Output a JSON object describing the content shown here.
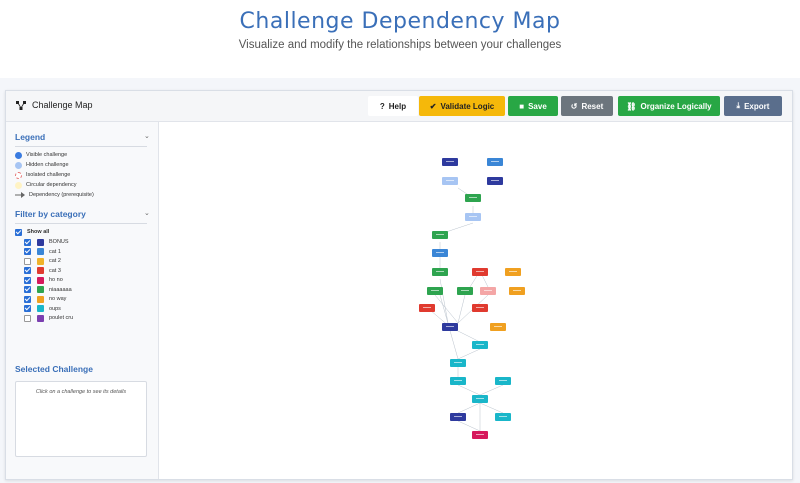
{
  "header": {
    "title": "Challenge Dependency Map",
    "subtitle": "Visualize and modify the relationships between your challenges"
  },
  "toolbar": {
    "title": "Challenge Map",
    "title_icon": "graph-icon",
    "buttons": [
      {
        "label": "Help",
        "icon": "question-circle-icon",
        "color": "#ffffff",
        "text": "#222222"
      },
      {
        "label": "Validate Logic",
        "icon": "check-circle-icon",
        "color": "#f5b80a",
        "text": "#222222"
      },
      {
        "label": "Save",
        "icon": "floppy-icon",
        "color": "#28a745",
        "text": "#ffffff"
      },
      {
        "label": "Reset",
        "icon": "undo-icon",
        "color": "#6c757d",
        "text": "#ffffff"
      },
      {
        "label": "Organize Logically",
        "icon": "graph-icon",
        "color": "#28a745",
        "text": "#ffffff"
      },
      {
        "label": "Export",
        "icon": "download-icon",
        "color": "#5a6e8c",
        "text": "#ffffff"
      }
    ]
  },
  "legend": {
    "title": "Legend",
    "items": [
      {
        "label": "Visible challenge",
        "type": "visible",
        "color": "#3a7be0"
      },
      {
        "label": "Hidden challenge",
        "type": "hidden",
        "color": "#a7c5f3"
      },
      {
        "label": "Isolated challenge",
        "type": "isolated",
        "color": "#e57373"
      },
      {
        "label": "Circular dependency",
        "type": "circular",
        "color": "#fff3c4"
      },
      {
        "label": "Dependency (prerequisite)",
        "type": "arrow",
        "color": "#666666"
      }
    ]
  },
  "filter": {
    "title": "Filter by category",
    "show_all_label": "Show all",
    "show_all_checked": true,
    "categories": [
      {
        "label": "BONUS",
        "color": "#2e3a9e",
        "checked": true
      },
      {
        "label": "cat 1",
        "color": "#3a86d6",
        "checked": true
      },
      {
        "label": "cat 2",
        "color": "#f0b32a",
        "checked": false
      },
      {
        "label": "cat 3",
        "color": "#e03a2f",
        "checked": true
      },
      {
        "label": "ho no",
        "color": "#d6195c",
        "checked": true
      },
      {
        "label": "niaaaaaa",
        "color": "#2ea44f",
        "checked": true
      },
      {
        "label": "no way",
        "color": "#f0a020",
        "checked": true
      },
      {
        "label": "oups",
        "color": "#19b6c9",
        "checked": true
      },
      {
        "label": "poulet cru",
        "color": "#7b3fb0",
        "checked": false
      }
    ]
  },
  "details": {
    "title": "Selected Challenge",
    "placeholder": "Click on a challenge to see its details"
  },
  "colors": {
    "accent": "#3a6fb8"
  }
}
